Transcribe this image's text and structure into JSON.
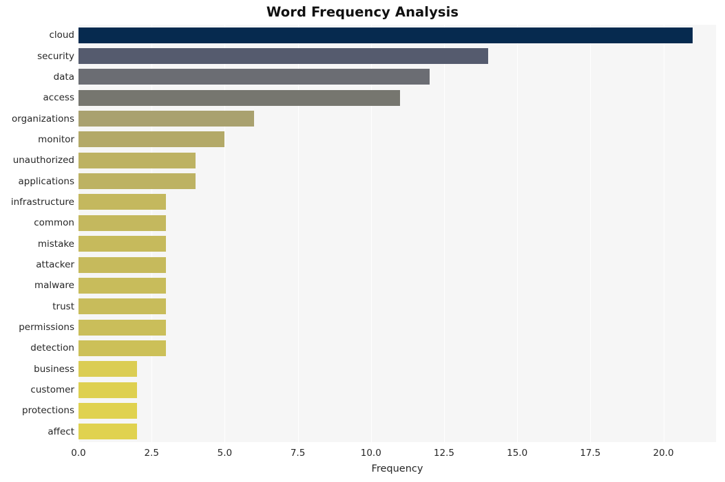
{
  "chart_data": {
    "type": "bar",
    "orientation": "horizontal",
    "title": "Word Frequency Analysis",
    "xlabel": "Frequency",
    "ylabel": "",
    "xlim": [
      0,
      21.8
    ],
    "xticks": [
      "0.0",
      "2.5",
      "5.0",
      "7.5",
      "10.0",
      "12.5",
      "15.0",
      "17.5",
      "20.0"
    ],
    "xtick_values": [
      0,
      2.5,
      5,
      7.5,
      10,
      12.5,
      15,
      17.5,
      20
    ],
    "grid": true,
    "grid_axis": "x",
    "legend": "none",
    "categories": [
      "cloud",
      "security",
      "data",
      "access",
      "organizations",
      "monitor",
      "unauthorized",
      "applications",
      "infrastructure",
      "common",
      "mistake",
      "attacker",
      "malware",
      "trust",
      "permissions",
      "detection",
      "business",
      "customer",
      "protections",
      "affect"
    ],
    "values": [
      21,
      14,
      12,
      11,
      6,
      5,
      4,
      4,
      3,
      3,
      3,
      3,
      3,
      3,
      3,
      3,
      2,
      2,
      2,
      2
    ],
    "bar_colors": [
      "#062a4f",
      "#555b6e",
      "#6b6d73",
      "#76766f",
      "#a9a16f",
      "#b3a968",
      "#bdb263",
      "#bdb263",
      "#c4b85e",
      "#c4b85e",
      "#c6ba5c",
      "#c6ba5c",
      "#c8bc5b",
      "#c8bc5b",
      "#cabe5a",
      "#ccc058",
      "#dbcd53",
      "#ded050",
      "#e0d24f",
      "#e0d24f"
    ],
    "plot_background": "#f6f6f6",
    "figure_background": "#ffffff",
    "gridline_color": "#ffffff",
    "text_color": "#262626"
  }
}
